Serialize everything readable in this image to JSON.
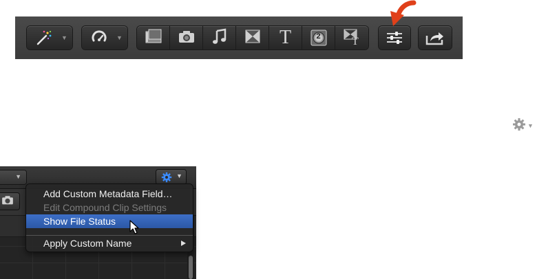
{
  "toolbar": {
    "buttons": [
      {
        "name": "enhancements-button",
        "icon": "magic-wand-icon",
        "has_menu": true
      },
      {
        "name": "retiming-button",
        "icon": "retime-speedometer-icon",
        "has_menu": true
      }
    ],
    "media_group": [
      {
        "name": "media-browser-button",
        "icon": "filmstrip-icon"
      },
      {
        "name": "photo-browser-button",
        "icon": "camera-icon"
      },
      {
        "name": "music-browser-button",
        "icon": "music-note-icon"
      },
      {
        "name": "transitions-browser-button",
        "icon": "transition-hourglass-icon"
      },
      {
        "name": "titles-browser-button",
        "icon": "title-t-icon",
        "glyph": "T"
      },
      {
        "name": "generators-browser-button",
        "icon": "generator-disc-icon",
        "glyph": "2"
      },
      {
        "name": "themes-browser-button",
        "icon": "themes-icon"
      }
    ],
    "inspector_button": {
      "icon": "inspector-sliders-icon"
    },
    "share_button": {
      "icon": "share-arrow-icon"
    }
  },
  "annotation": {
    "icon": "red-arrow-icon",
    "color": "#e0401a"
  },
  "gear_right": {
    "icon": "gear-icon"
  },
  "menu": {
    "items": [
      {
        "label": "Add Custom Metadata Field…",
        "enabled": true
      },
      {
        "label": "Edit Compound Clip Settings",
        "enabled": false
      },
      {
        "label": "Show File Status",
        "enabled": true,
        "highlighted": true
      },
      {
        "label": "Apply Custom Name",
        "enabled": true,
        "submenu": true
      }
    ]
  },
  "colors": {
    "toolbar_bg": "#444444",
    "highlight": "#3366bb",
    "arrow": "#e0401a",
    "action_gear": "#3b8cff"
  }
}
